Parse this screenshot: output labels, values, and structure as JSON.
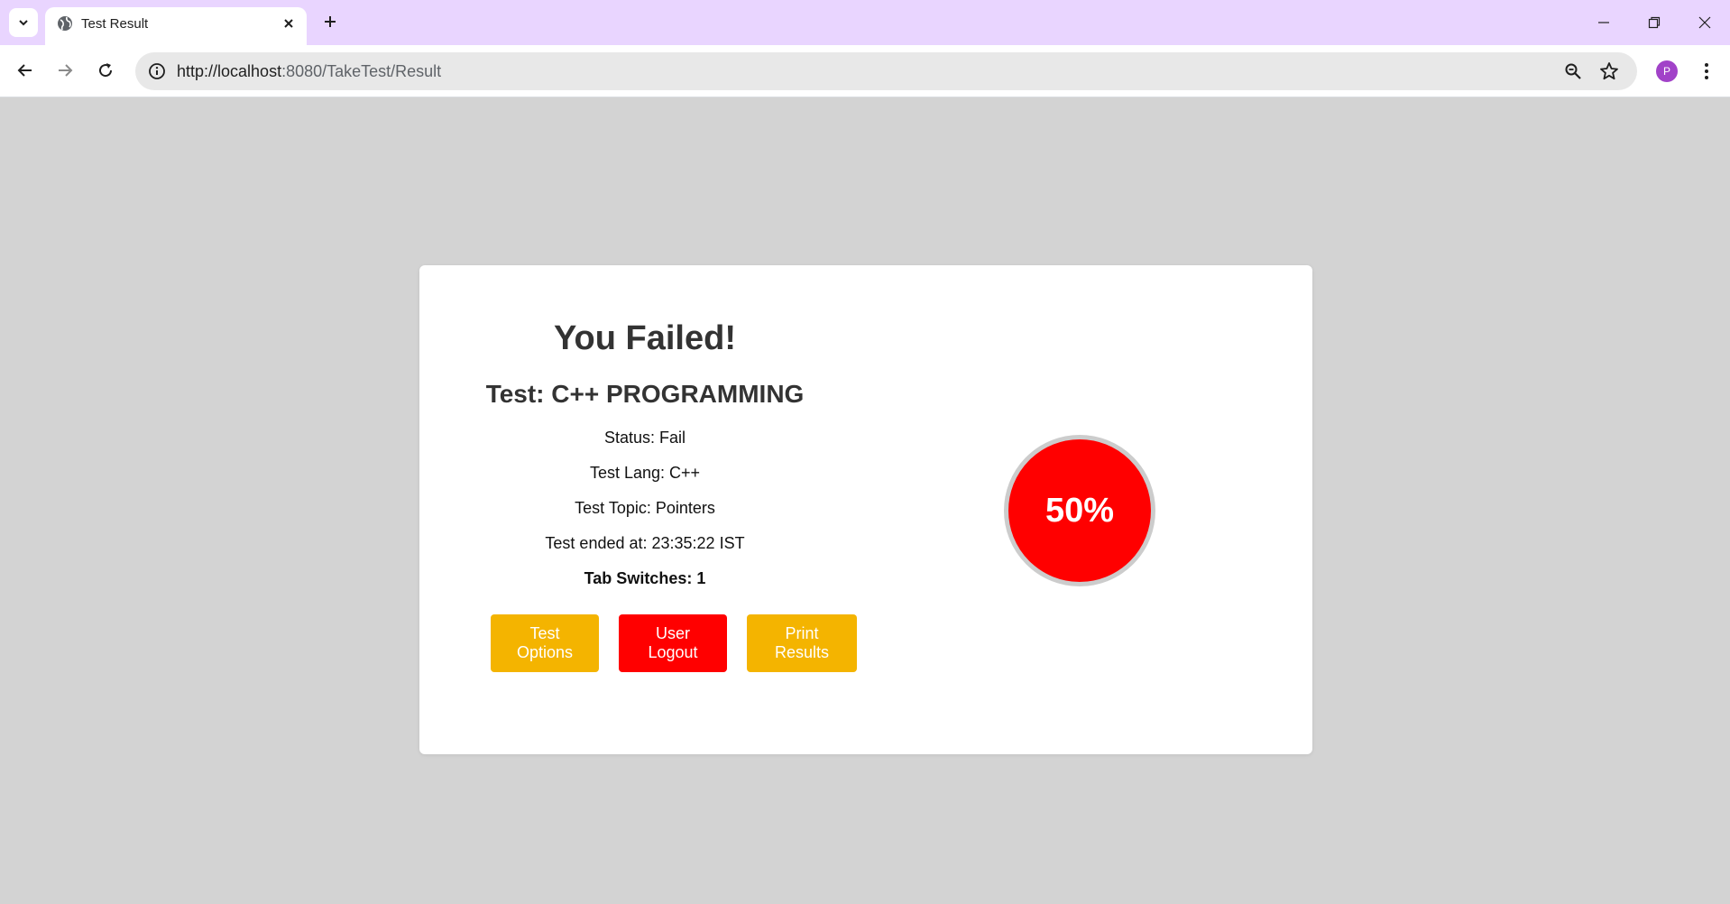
{
  "browser": {
    "tab_title": "Test Result",
    "url_host": "http://localhost",
    "url_rest": ":8080/TakeTest/Result",
    "profile_initial": "P"
  },
  "result": {
    "heading": "You Failed!",
    "test_title": "Test: C++ PROGRAMMING",
    "status": "Status: Fail",
    "lang": "Test Lang: C++",
    "topic": "Test Topic: Pointers",
    "ended": "Test ended at: 23:35:22 IST",
    "tab_switches": "Tab Switches: 1",
    "score_text": "50%",
    "score_value": 50
  },
  "actions": {
    "test_options": "Test Options",
    "user_logout": "User Logout",
    "print_results": "Print Results"
  },
  "colors": {
    "fail": "#ff0000",
    "accent": "#f4b400",
    "page_bg": "#d3d3d3",
    "tabbar_bg": "#e9d5ff"
  }
}
